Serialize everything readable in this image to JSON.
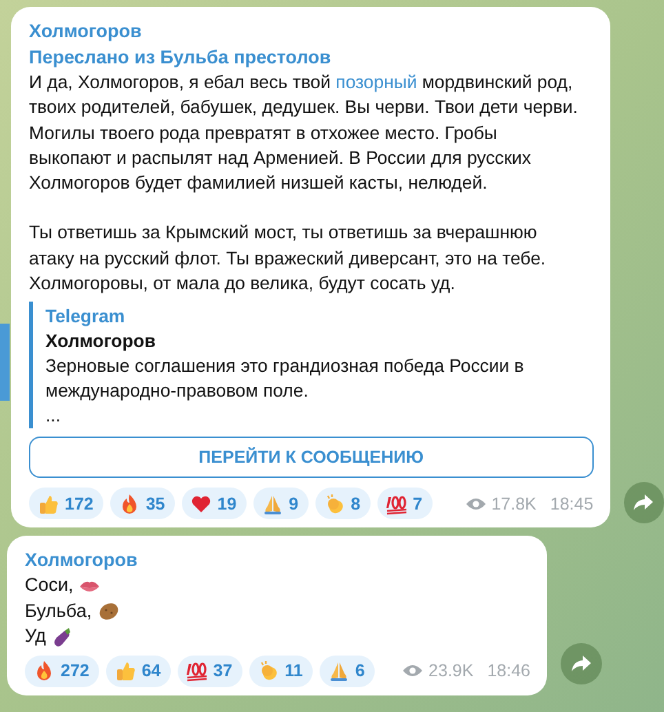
{
  "messages": [
    {
      "author": "Холмогоров",
      "forwarded_from": "Переслано из Бульба престолов",
      "paragraphs": [
        [
          {
            "text": "И да, Холмогоров, я ебал весь твой ",
            "link": false
          },
          {
            "text": "позорный",
            "link": true
          },
          {
            "text": " мордвинский род,\nтвоих родителей, бабушек, дедушек. Вы черви. Твои дети черви.\nМогилы твоего рода превратят в отхожее место. Гробы\nвыкопают и распылят над Арменией. В России для русских\nХолмогоров будет фамилией низшей касты, нелюдей.",
            "link": false
          }
        ],
        [
          {
            "text": "Ты ответишь за Крымский мост, ты ответишь за вчерашнюю\nатаку на русский флот. Ты вражеский диверсант, это на тебе.\nХолмогоровы, от мала до велика, будут сосать уд.",
            "link": false
          }
        ]
      ],
      "preview": {
        "site": "Telegram",
        "title": "Холмогоров",
        "text": "Зерновые соглашения это грандиозная победа России в\nмеждународно-правовом поле.",
        "more": "..."
      },
      "button": "ПЕРЕЙТИ К СООБЩЕНИЮ",
      "reactions": [
        {
          "kind": "thumbs",
          "count": "172"
        },
        {
          "kind": "fire",
          "count": "35"
        },
        {
          "kind": "heart",
          "count": "19"
        },
        {
          "kind": "pray",
          "count": "9"
        },
        {
          "kind": "clap",
          "count": "8"
        },
        {
          "kind": "hundred",
          "count": "7"
        }
      ],
      "views": "17.8K",
      "time": "18:45"
    },
    {
      "author": "Холмогоров",
      "lines": [
        {
          "text": "Соси,",
          "kind": "lips"
        },
        {
          "text": "Бульба,",
          "kind": "potato"
        },
        {
          "text": "Уд",
          "kind": "eggplant"
        }
      ],
      "reactions": [
        {
          "kind": "fire",
          "count": "272"
        },
        {
          "kind": "thumbs",
          "count": "64"
        },
        {
          "kind": "hundred",
          "count": "37"
        },
        {
          "kind": "clap",
          "count": "11"
        },
        {
          "kind": "pray",
          "count": "6"
        }
      ],
      "views": "23.9K",
      "time": "18:46"
    }
  ]
}
